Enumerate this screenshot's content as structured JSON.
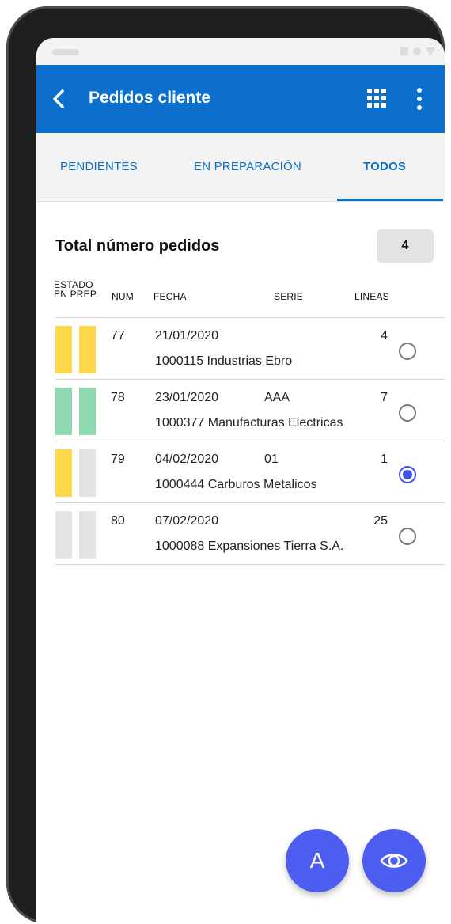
{
  "app": {
    "title": "Pedidos cliente",
    "icons": {
      "back": "chevron-left-icon",
      "grid": "apps-grid-icon",
      "more": "more-vert-icon"
    },
    "accent_color": "#0b6fcb",
    "fab_color": "#4d5df0"
  },
  "tabs": [
    {
      "label": "PENDIENTES",
      "active": false
    },
    {
      "label": "EN PREPARACIÓN",
      "active": false
    },
    {
      "label": "TODOS",
      "active": true
    }
  ],
  "summary": {
    "label": "Total número pedidos",
    "count": "4"
  },
  "columns": {
    "estado_line1": "ESTADO",
    "estado_line2": "EN PREP.",
    "num": "NUM",
    "fecha": "FECHA",
    "serie": "SERIE",
    "lineas": "LINEAS"
  },
  "orders": [
    {
      "num": "77",
      "fecha": "21/01/2020",
      "serie": "",
      "lineas": "4",
      "cliente": "1000115  Industrias Ebro",
      "estado_color": "#fcd84a",
      "prep_color": "#fcd84a",
      "selected": false
    },
    {
      "num": "78",
      "fecha": "23/01/2020",
      "serie": "AAA",
      "lineas": "7",
      "cliente": "1000377  Manufacturas Electricas",
      "estado_color": "#8fd9b1",
      "prep_color": "#8fd9b1",
      "selected": false
    },
    {
      "num": "79",
      "fecha": "04/02/2020",
      "serie": "01",
      "lineas": "1",
      "cliente": "1000444  Carburos Metalicos",
      "estado_color": "#fcd84a",
      "prep_color": "#e4e4e4",
      "selected": true
    },
    {
      "num": "80",
      "fecha": "07/02/2020",
      "serie": "",
      "lineas": "25",
      "cliente": "1000088  Expansiones Tierra S.A.",
      "estado_color": "#e4e4e4",
      "prep_color": "#e4e4e4",
      "selected": false
    }
  ],
  "fabs": {
    "a_label": "A",
    "eye_icon": "eye-icon"
  }
}
